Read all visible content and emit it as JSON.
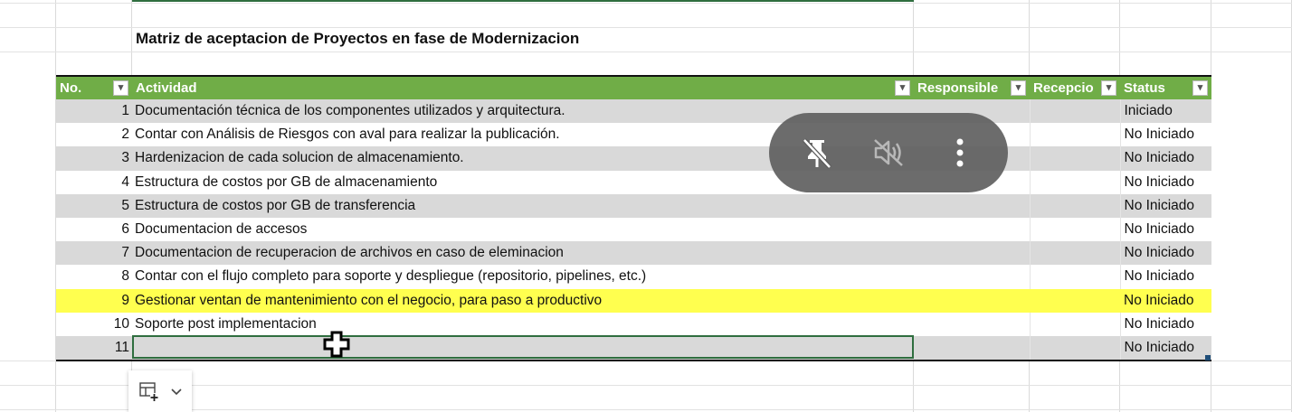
{
  "sheet": {
    "title": "Matriz de aceptacion de Proyectos en fase de Modernizacion"
  },
  "table": {
    "headers": {
      "no": "No.",
      "actividad": "Actividad",
      "responsible": "Responsible",
      "recepcion": "Recepcio",
      "status": "Status"
    },
    "rows": [
      {
        "no": "1",
        "actividad": "Documentación técnica de los componentes utilizados y arquitectura.",
        "responsible": "",
        "recepcion": "",
        "status": "Iniciado"
      },
      {
        "no": "2",
        "actividad": "Contar con Análisis de Riesgos con aval para realizar la publicación.",
        "responsible": "",
        "recepcion": "",
        "status": "No Iniciado"
      },
      {
        "no": "3",
        "actividad": "Hardenizacion de cada solucion de almacenamiento.",
        "responsible": "",
        "recepcion": "",
        "status": "No Iniciado"
      },
      {
        "no": "4",
        "actividad": "Estructura de costos por GB de almacenamiento",
        "responsible": "",
        "recepcion": "",
        "status": "No Iniciado"
      },
      {
        "no": "5",
        "actividad": "Estructura de costos por GB de transferencia",
        "responsible": "",
        "recepcion": "",
        "status": "No Iniciado"
      },
      {
        "no": "6",
        "actividad": "Documentacion de accesos",
        "responsible": "",
        "recepcion": "",
        "status": "No Iniciado"
      },
      {
        "no": "7",
        "actividad": "Documentacion de recuperacion de archivos en caso de eleminacion",
        "responsible": "",
        "recepcion": "",
        "status": "No Iniciado"
      },
      {
        "no": "8",
        "actividad": "Contar con el flujo completo para soporte y despliegue (repositorio, pipelines, etc.)",
        "responsible": "",
        "recepcion": "",
        "status": "No Iniciado"
      },
      {
        "no": "9",
        "actividad": "Gestionar ventan de mantenimiento con el negocio, para paso a productivo",
        "responsible": "",
        "recepcion": "",
        "status": "No Iniciado"
      },
      {
        "no": "10",
        "actividad": "Soporte post implementacion",
        "responsible": "",
        "recepcion": "",
        "status": "No Iniciado"
      },
      {
        "no": "11",
        "actividad": "",
        "responsible": "",
        "recepcion": "",
        "status": "No Iniciado"
      }
    ]
  },
  "colors": {
    "header_bg": "#70ad47",
    "band_gray": "#d9d9d9",
    "highlight_yellow": "#ffff4f",
    "selection_border": "#2f6e3f"
  },
  "overlay": {
    "icons": [
      "unpin-icon",
      "muted-speaker-icon",
      "more-vertical-icon"
    ]
  },
  "quick_analysis": {
    "icons": [
      "insert-table-icon",
      "chevron-down-icon"
    ]
  }
}
